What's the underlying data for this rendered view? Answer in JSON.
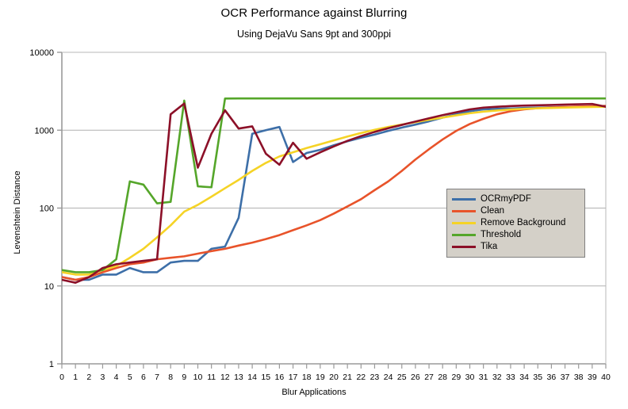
{
  "chart_data": {
    "type": "line",
    "title": "OCR Performance against Blurring",
    "subtitle": "Using DejaVu Sans 9pt and 300ppi",
    "xlabel": "Blur Applications",
    "ylabel": "Levenshtein Distance",
    "yscale": "log",
    "ylim": [
      1,
      10000
    ],
    "xlim": [
      0,
      40
    ],
    "grid": true,
    "legend_position": "center-right",
    "ytick_labels": [
      "1",
      "10",
      "100",
      "1000",
      "10000"
    ],
    "ytick_values": [
      1,
      10,
      100,
      1000,
      10000
    ],
    "xtick_labels": [
      "0",
      "1",
      "2",
      "3",
      "4",
      "5",
      "6",
      "7",
      "8",
      "9",
      "10",
      "11",
      "12",
      "13",
      "14",
      "15",
      "16",
      "17",
      "18",
      "19",
      "20",
      "21",
      "22",
      "23",
      "24",
      "25",
      "26",
      "27",
      "28",
      "29",
      "30",
      "31",
      "32",
      "33",
      "34",
      "35",
      "36",
      "37",
      "38",
      "39",
      "40"
    ],
    "x": [
      0,
      1,
      2,
      3,
      4,
      5,
      6,
      7,
      8,
      9,
      10,
      11,
      12,
      13,
      14,
      15,
      16,
      17,
      18,
      19,
      20,
      21,
      22,
      23,
      24,
      25,
      26,
      27,
      28,
      29,
      30,
      31,
      32,
      33,
      34,
      35,
      36,
      37,
      38,
      39,
      40
    ],
    "series": [
      {
        "name": "OCRmyPDF",
        "color": "#3d6fa8",
        "values": [
          13,
          12,
          12,
          14,
          14,
          17,
          15,
          15,
          20,
          21,
          21,
          30,
          32,
          75,
          900,
          1000,
          1100,
          390,
          510,
          560,
          640,
          720,
          800,
          880,
          980,
          1080,
          1180,
          1300,
          1450,
          1600,
          1750,
          1850,
          1880,
          1900,
          1930,
          1950,
          1970,
          1990,
          2000,
          2020,
          2050
        ]
      },
      {
        "name": "Clean",
        "color": "#e8532a",
        "values": [
          13,
          12,
          13,
          15,
          17,
          19,
          20,
          22,
          23,
          24,
          26,
          28,
          30,
          33,
          36,
          40,
          45,
          52,
          60,
          70,
          85,
          105,
          130,
          170,
          220,
          300,
          420,
          570,
          760,
          980,
          1200,
          1400,
          1600,
          1750,
          1850,
          1920,
          1960,
          1990,
          2010,
          2030,
          2050
        ]
      },
      {
        "name": "Remove Background",
        "color": "#f5d326",
        "values": [
          15,
          14,
          14,
          16,
          18,
          23,
          30,
          42,
          60,
          90,
          110,
          140,
          180,
          230,
          300,
          380,
          460,
          520,
          590,
          660,
          740,
          830,
          920,
          1010,
          1100,
          1180,
          1270,
          1360,
          1450,
          1550,
          1650,
          1730,
          1790,
          1840,
          1880,
          1910,
          1930,
          1950,
          1970,
          1985,
          2000
        ]
      },
      {
        "name": "Threshold",
        "color": "#55a62a",
        "values": [
          16,
          15,
          15,
          16,
          22,
          220,
          200,
          115,
          120,
          2400,
          190,
          185,
          2550,
          2560,
          2560,
          2560,
          2560,
          2560,
          2560,
          2560,
          2560,
          2560,
          2560,
          2560,
          2560,
          2560,
          2560,
          2560,
          2560,
          2560,
          2560,
          2560,
          2560,
          2560,
          2560,
          2560,
          2560,
          2560,
          2560,
          2560,
          2560
        ]
      },
      {
        "name": "Tika",
        "color": "#8c1028",
        "values": [
          12,
          11,
          13,
          17,
          19,
          20,
          21,
          22,
          1600,
          2200,
          330,
          900,
          1800,
          1050,
          1120,
          500,
          360,
          690,
          430,
          520,
          620,
          730,
          840,
          950,
          1060,
          1170,
          1290,
          1420,
          1560,
          1700,
          1850,
          1950,
          2000,
          2040,
          2070,
          2090,
          2110,
          2130,
          2150,
          2170,
          2000
        ]
      }
    ]
  },
  "legend": {
    "entries": [
      {
        "label": "OCRmyPDF",
        "color": "#3d6fa8"
      },
      {
        "label": "Clean",
        "color": "#e8532a"
      },
      {
        "label": "Remove Background",
        "color": "#f5d326"
      },
      {
        "label": "Threshold",
        "color": "#55a62a"
      },
      {
        "label": "Tika",
        "color": "#8c1028"
      }
    ]
  }
}
